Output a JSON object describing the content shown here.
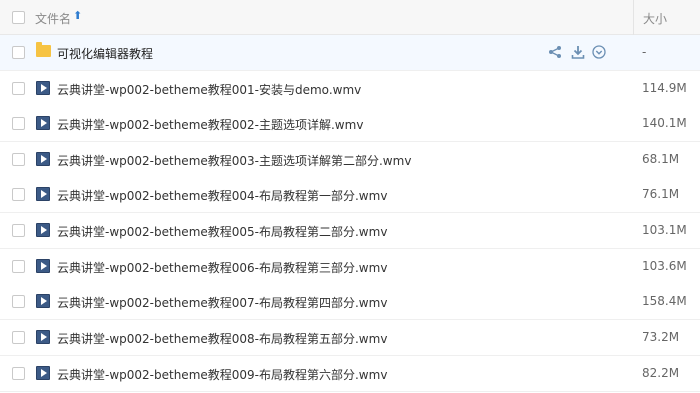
{
  "header": {
    "name_label": "文件名",
    "sort_icon": "arrow-up-icon",
    "size_label": "大小"
  },
  "actions": {
    "share_icon": "share-icon",
    "download_icon": "download-icon",
    "more_icon": "chevron-down-circle-icon"
  },
  "rows": [
    {
      "type": "folder",
      "name": "可视化编辑器教程",
      "size": "-"
    },
    {
      "type": "video",
      "name": "云典讲堂-wp002-betheme教程001-安装与demo.wmv",
      "size": "114.9M"
    },
    {
      "type": "video",
      "name": "云典讲堂-wp002-betheme教程002-主题选项详解.wmv",
      "size": "140.1M"
    },
    {
      "type": "video",
      "name": "云典讲堂-wp002-betheme教程003-主题选项详解第二部分.wmv",
      "size": "68.1M"
    },
    {
      "type": "video",
      "name": "云典讲堂-wp002-betheme教程004-布局教程第一部分.wmv",
      "size": "76.1M"
    },
    {
      "type": "video",
      "name": "云典讲堂-wp002-betheme教程005-布局教程第二部分.wmv",
      "size": "103.1M"
    },
    {
      "type": "video",
      "name": "云典讲堂-wp002-betheme教程006-布局教程第三部分.wmv",
      "size": "103.6M"
    },
    {
      "type": "video",
      "name": "云典讲堂-wp002-betheme教程007-布局教程第四部分.wmv",
      "size": "158.4M"
    },
    {
      "type": "video",
      "name": "云典讲堂-wp002-betheme教程008-布局教程第五部分.wmv",
      "size": "73.2M"
    },
    {
      "type": "video",
      "name": "云典讲堂-wp002-betheme教程009-布局教程第六部分.wmv",
      "size": "82.2M"
    }
  ],
  "colors": {
    "accent": "#2e7ccf",
    "folder": "#f6c343",
    "video_icon": "#3c5a86",
    "selected_row": "#f4f9ff"
  }
}
